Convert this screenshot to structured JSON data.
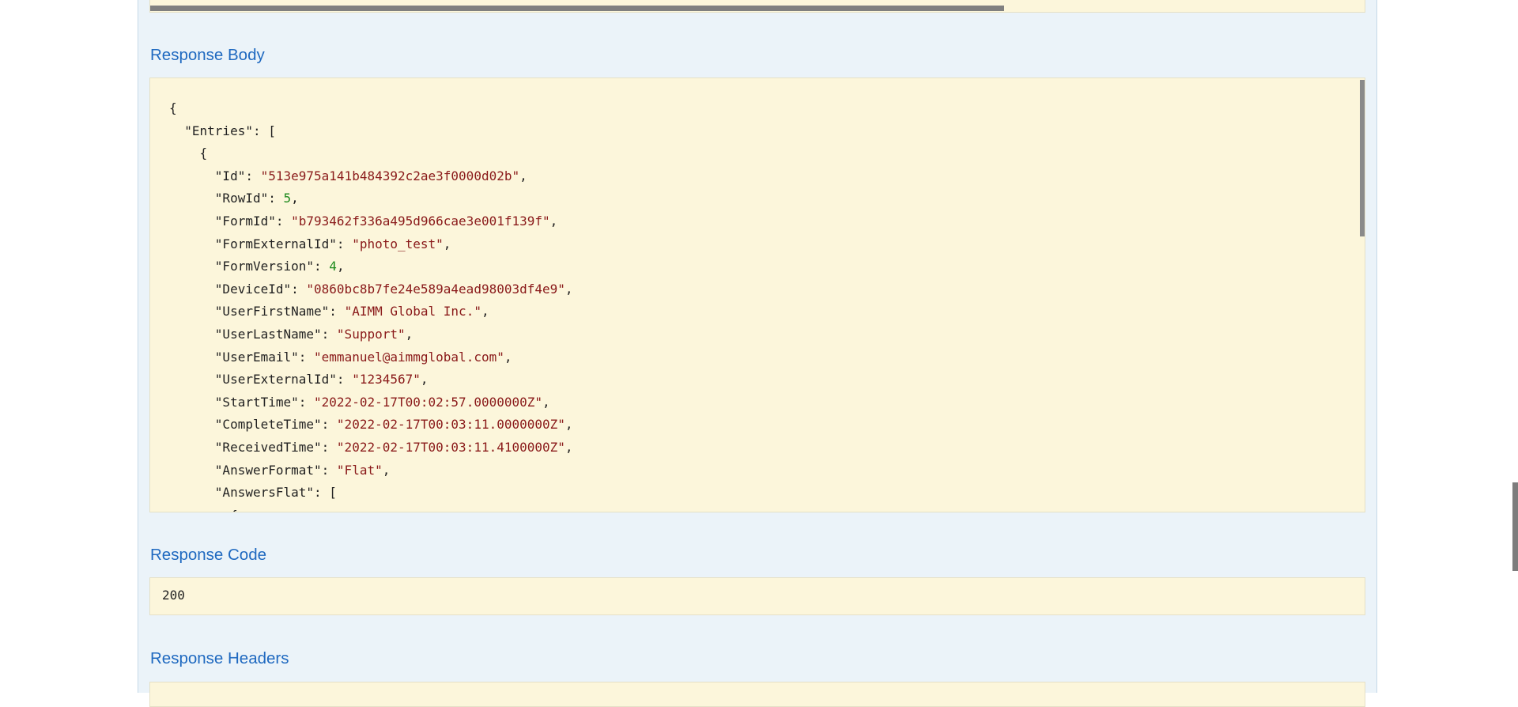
{
  "sections": {
    "response_body_title": "Response Body",
    "response_code_title": "Response Code",
    "response_headers_title": "Response Headers"
  },
  "response_body_lines": [
    "{",
    "  \"Entries\": [",
    "    {",
    "      \"Id\": \"513e975a141b484392c2ae3f0000d02b\",",
    "      \"RowId\": 5,",
    "      \"FormId\": \"b793462f336a495d966cae3e001f139f\",",
    "      \"FormExternalId\": \"photo_test\",",
    "      \"FormVersion\": 4,",
    "      \"DeviceId\": \"0860bc8b7fe24e589a4ead98003df4e9\",",
    "      \"UserFirstName\": \"AIMM Global Inc.\",",
    "      \"UserLastName\": \"Support\",",
    "      \"UserEmail\": \"emmanuel@aimmglobal.com\",",
    "      \"UserExternalId\": \"1234567\",",
    "      \"StartTime\": \"2022-02-17T00:02:57.0000000Z\",",
    "      \"CompleteTime\": \"2022-02-17T00:03:11.0000000Z\",",
    "      \"ReceivedTime\": \"2022-02-17T00:03:11.4100000Z\",",
    "      \"AnswerFormat\": \"Flat\",",
    "      \"AnswersFlat\": [",
    "        {"
  ],
  "response_code": "200",
  "colors": {
    "section_title": "#1f69c0",
    "code_background": "#fcf6db",
    "panel_background": "#ebf3f9",
    "string_value": "#8a1a1a",
    "number_value": "#1d8a1d"
  }
}
